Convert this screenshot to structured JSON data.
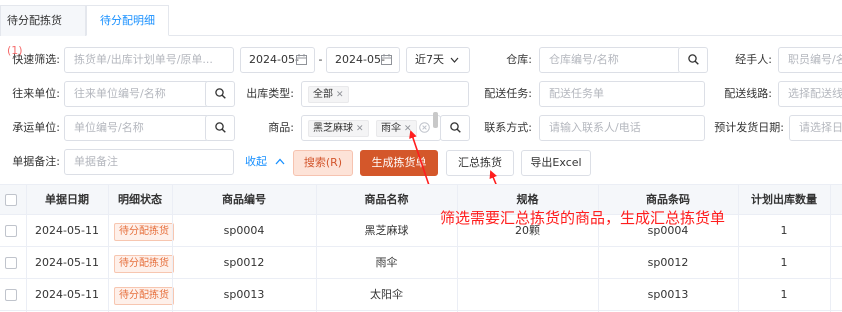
{
  "tabs": [
    {
      "label": "待分配拣货",
      "count": "(1)"
    },
    {
      "label": "待分配明细"
    }
  ],
  "filters": {
    "quick": {
      "label": "快速筛选:",
      "placeholder": "拣货单/出库计划单号/原单..."
    },
    "date_start": "2024-05-",
    "date_sep": "-",
    "date_end": "2024-05-",
    "range": "近7天",
    "warehouse": {
      "label": "仓库:",
      "placeholder": "仓库编号/名称"
    },
    "handler": {
      "label": "经手人:",
      "placeholder": "职员编号/名"
    },
    "contact_unit": {
      "label": "往来单位:",
      "placeholder": "往来单位编号/名称"
    },
    "out_type": {
      "label": "出库类型:",
      "tag": "全部"
    },
    "delivery_task": {
      "label": "配送任务:",
      "placeholder": "配送任务单"
    },
    "delivery_route": {
      "label": "配送线路:",
      "placeholder": "选择配送线路"
    },
    "carrier": {
      "label": "承运单位:",
      "placeholder": "单位编号/名称"
    },
    "goods": {
      "label": "商品:",
      "tags": [
        "黑芝麻球",
        "雨伞"
      ]
    },
    "contact": {
      "label": "联系方式:",
      "placeholder": "请输入联系人/电话"
    },
    "planned_date": {
      "label": "预计发货日期:",
      "placeholder": "请选择日"
    },
    "remark": {
      "label": "单据备注:",
      "placeholder": "单据备注"
    },
    "collapse": "收起"
  },
  "buttons": {
    "search": "搜索(R)",
    "generate": "生成拣货单",
    "summary": "汇总拣货",
    "export": "导出Excel"
  },
  "table": {
    "headers": [
      "单据日期",
      "明细状态",
      "商品编号",
      "商品名称",
      "规格",
      "商品条码",
      "计划出库数量"
    ],
    "rows": [
      [
        "2024-05-11",
        "待分配拣货",
        "sp0004",
        "黑芝麻球",
        "20颗",
        "sp0004",
        "1"
      ],
      [
        "2024-05-11",
        "待分配拣货",
        "sp0012",
        "雨伞",
        "",
        "sp0012",
        "1"
      ],
      [
        "2024-05-11",
        "待分配拣货",
        "sp0013",
        "太阳伞",
        "",
        "sp0013",
        "1"
      ]
    ]
  },
  "annotation": "筛选需要汇总拣货的商品，生成汇总拣货单",
  "colors": {
    "accent": "#1890ff",
    "primary_button": "#d4572a",
    "annotation": "#ff1e1e"
  }
}
